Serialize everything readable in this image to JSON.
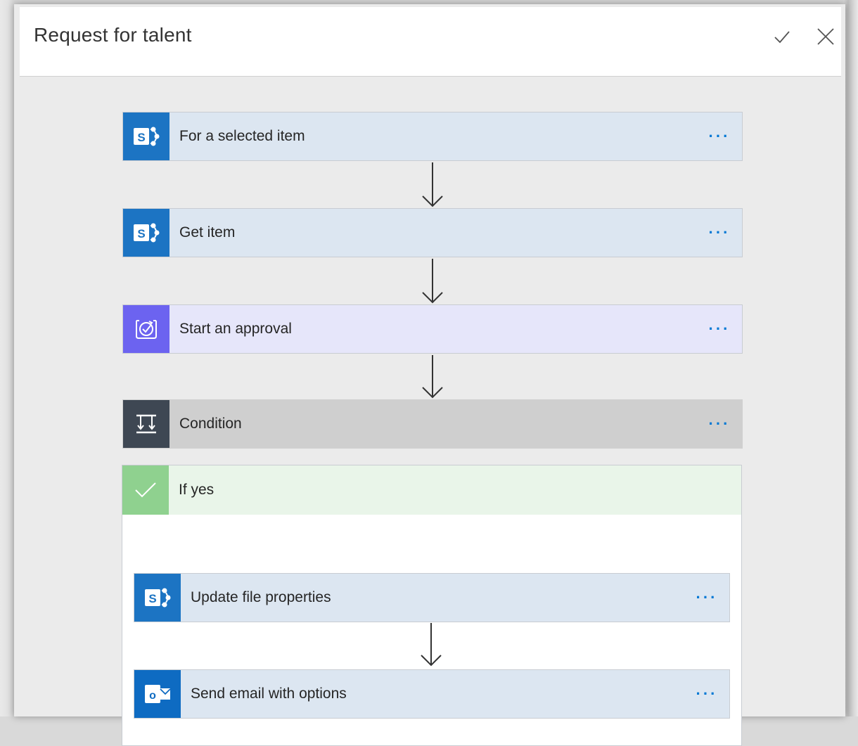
{
  "panel": {
    "title": "Request for talent",
    "confirm_icon": "check-icon",
    "close_icon": "close-icon"
  },
  "steps": [
    {
      "label": "For a selected item",
      "icon": "sharepoint-icon",
      "more": "···"
    },
    {
      "label": "Get item",
      "icon": "sharepoint-icon",
      "more": "···"
    },
    {
      "label": "Start an approval",
      "icon": "approval-icon",
      "more": "···"
    },
    {
      "label": "Condition",
      "icon": "condition-icon",
      "more": "···"
    }
  ],
  "branch_yes": {
    "label": "If yes",
    "icon": "check-icon",
    "steps": [
      {
        "label": "Update file properties",
        "icon": "sharepoint-icon",
        "more": "···"
      },
      {
        "label": "Send email with options",
        "icon": "outlook-icon",
        "more": "···"
      }
    ]
  },
  "colors": {
    "sharepoint": "#1c74c3",
    "approval": "#6c63f0",
    "condition": "#3e4753",
    "yes_branch": "#8fd18f",
    "more_dots": "#0078d4"
  }
}
